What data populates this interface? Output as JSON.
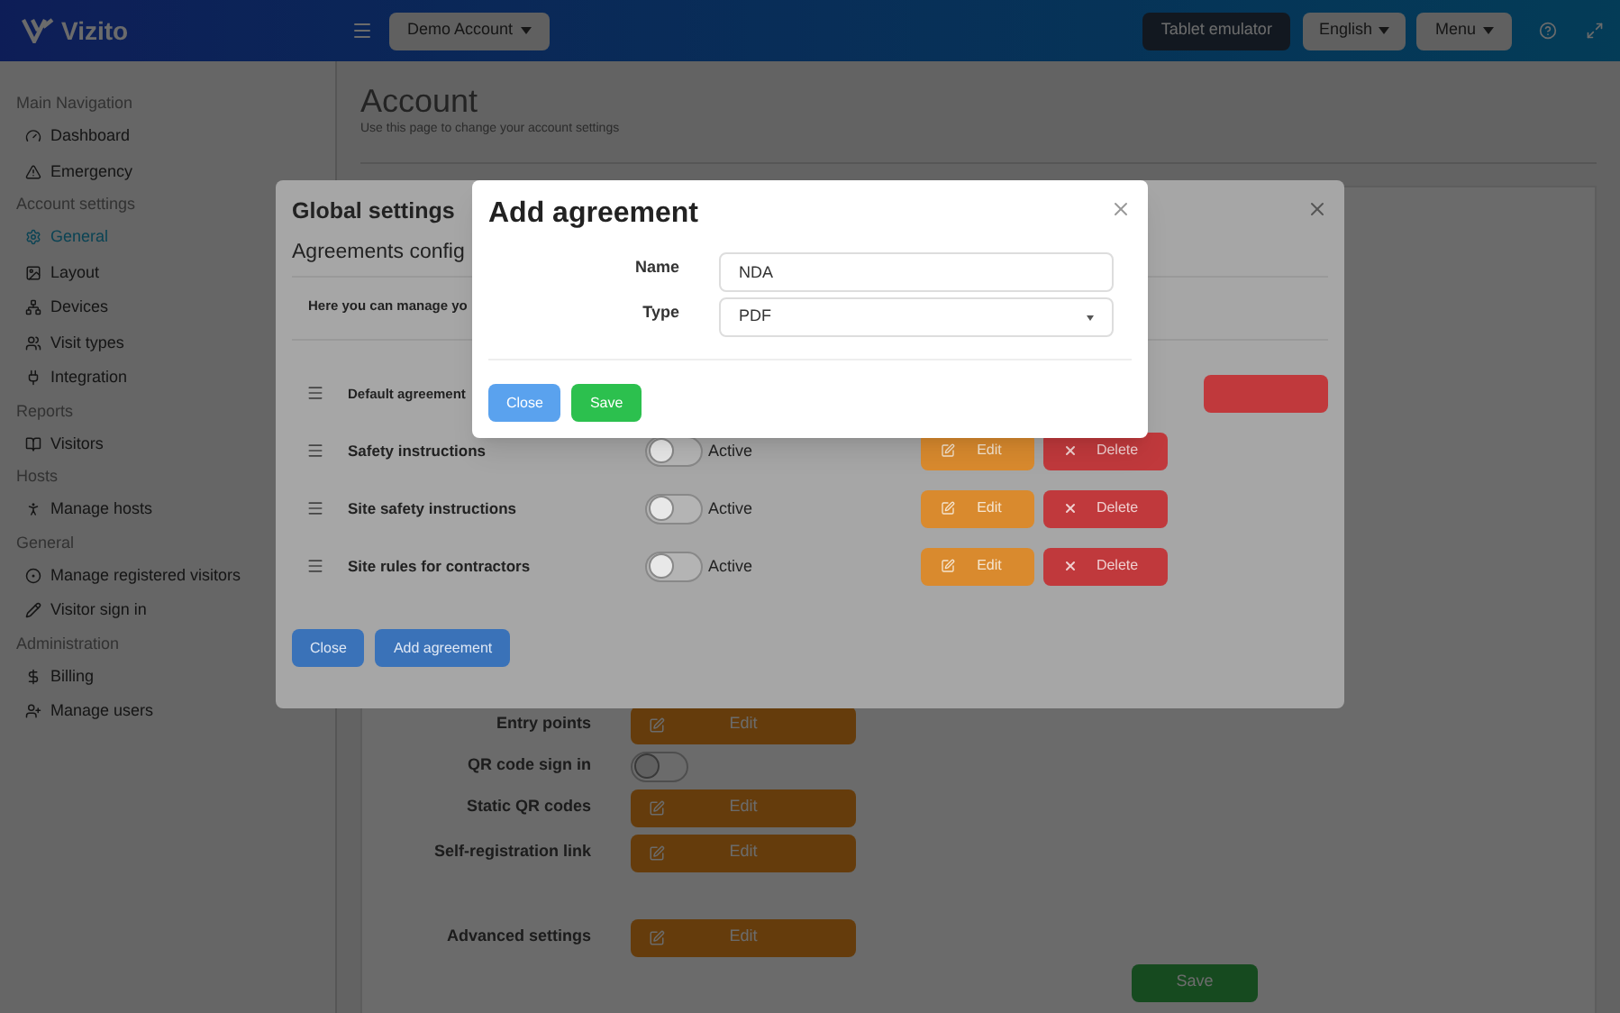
{
  "header": {
    "logo": "Vizito",
    "account_button": "Demo Account",
    "tablet_button": "Tablet emulator",
    "language_button": "English",
    "menu_button": "Menu"
  },
  "sidebar": {
    "sections": [
      {
        "title": "Main Navigation",
        "items": [
          {
            "label": "Dashboard",
            "selected": false
          },
          {
            "label": "Emergency",
            "selected": false
          }
        ]
      },
      {
        "title": "Account settings",
        "items": [
          {
            "label": "General",
            "selected": true
          },
          {
            "label": "Layout",
            "selected": false
          },
          {
            "label": "Devices",
            "selected": false
          },
          {
            "label": "Visit types",
            "selected": false
          },
          {
            "label": "Integration",
            "selected": false
          }
        ]
      },
      {
        "title": "Reports",
        "items": [
          {
            "label": "Visitors",
            "selected": false
          }
        ]
      },
      {
        "title": "Hosts",
        "items": [
          {
            "label": "Manage hosts",
            "selected": false
          }
        ]
      },
      {
        "title": "General",
        "items": [
          {
            "label": "Manage registered visitors",
            "selected": false
          },
          {
            "label": "Visitor sign in",
            "selected": false
          }
        ]
      },
      {
        "title": "Administration",
        "items": [
          {
            "label": "Billing",
            "selected": false
          },
          {
            "label": "Manage users",
            "selected": false
          }
        ]
      }
    ]
  },
  "page": {
    "title": "Account",
    "subtitle": "Use this page to change your account settings",
    "settings": [
      {
        "kind": "edit",
        "label": "Entry points",
        "button": "Edit"
      },
      {
        "kind": "toggle",
        "label": "QR code sign in",
        "on": false
      },
      {
        "kind": "edit",
        "label": "Static QR codes",
        "button": "Edit"
      },
      {
        "kind": "edit",
        "label": "Self-registration link",
        "button": "Edit"
      },
      {
        "kind": "edit",
        "label": "Advanced settings",
        "button": "Edit"
      }
    ],
    "save_button": "Save"
  },
  "global_modal": {
    "title": "Global settings",
    "section_title": "Agreements config",
    "intro": "Here you can manage yo",
    "agreements": [
      {
        "kind": "covered",
        "name": "Default agreement"
      },
      {
        "kind": "full",
        "name": "Safety instructions",
        "on": false,
        "status": "Active",
        "edit": "Edit",
        "delete": "Delete"
      },
      {
        "kind": "full",
        "name": "Site safety instructions",
        "on": false,
        "status": "Active",
        "edit": "Edit",
        "delete": "Delete"
      },
      {
        "kind": "full",
        "name": "Site rules for contractors",
        "on": false,
        "status": "Active",
        "edit": "Edit",
        "delete": "Delete"
      }
    ],
    "buttons": [
      "Close",
      "Add agreement"
    ]
  },
  "add_modal": {
    "title": "Add agreement",
    "fields": [
      {
        "kind": "text",
        "label": "Name",
        "value": "NDA"
      },
      {
        "kind": "select",
        "label": "Type",
        "value": "PDF"
      }
    ],
    "buttons": [
      {
        "kind": "close",
        "label": "Close"
      },
      {
        "kind": "save",
        "label": "Save"
      }
    ]
  }
}
